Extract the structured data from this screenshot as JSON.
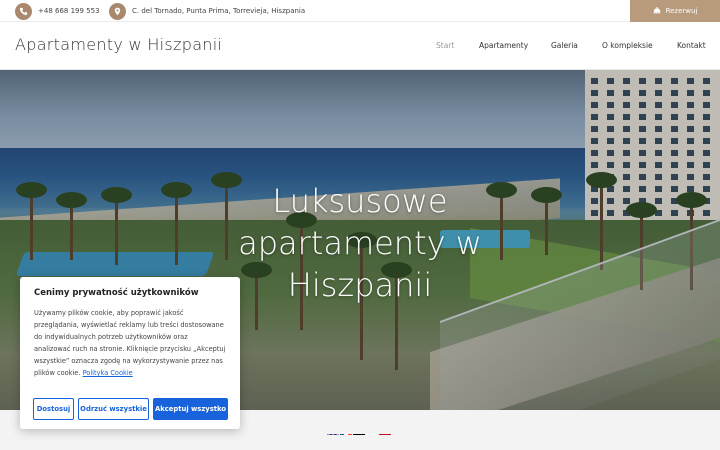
{
  "topbar": {
    "phone": "+48 668 199 553",
    "address": "C. del Tornado, Punta Prima, Torrevieja, Hiszpania",
    "reserve_label": "Rezerwuj",
    "phone_icon": "phone-icon",
    "address_icon": "map-pin-icon",
    "reserve_icon": "bell-icon"
  },
  "header": {
    "brand": "Apartamenty w Hiszpanii",
    "nav": [
      {
        "label": "Start",
        "active": true
      },
      {
        "label": "Apartamenty",
        "active": false
      },
      {
        "label": "Galeria",
        "active": false
      },
      {
        "label": "O kompleksie",
        "active": false
      },
      {
        "label": "Kontakt",
        "active": false
      }
    ]
  },
  "hero": {
    "title_line1": "Luksusowe",
    "title_line2": "apartamenty w",
    "title_line3": "Hiszpanii"
  },
  "cookie": {
    "title": "Cenimy prywatność użytkowników",
    "text": "Używamy plików cookie, aby poprawić jakość przeglądania, wyświetlać reklamy lub treści dostosowane do indywidualnych potrzeb użytkowników oraz analizować ruch na stronie. Kliknięcie przycisku „Akceptuj wszystkie” oznacza zgodę na wykorzystywanie przez nas plików cookie.",
    "link": "Polityka Cookie",
    "buttons": {
      "customize": "Dostosuj",
      "reject": "Odrzuć wszystkie",
      "accept": "Akceptuj wszystko"
    }
  },
  "languages": [
    "en-flag-icon",
    "fr-flag-icon",
    "de-flag-icon",
    "pl-flag-icon",
    "es-flag-icon"
  ],
  "colors": {
    "accent": "#b89a7c",
    "cookie_primary": "#1863dc"
  }
}
